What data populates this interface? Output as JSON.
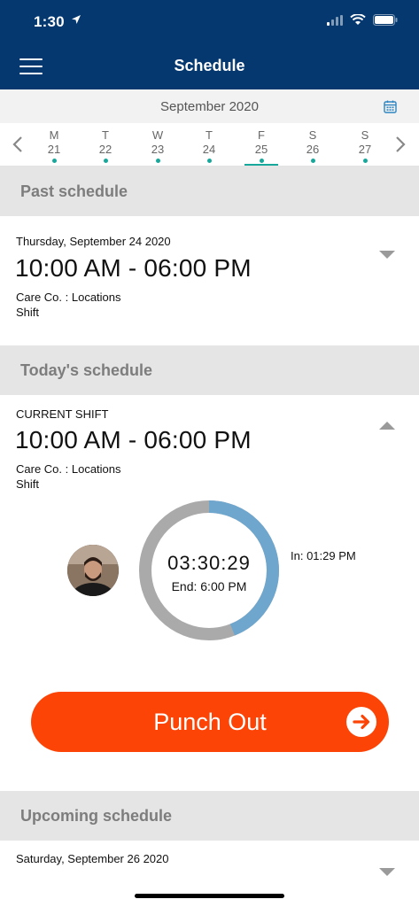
{
  "status_bar": {
    "time": "1:30"
  },
  "header": {
    "title": "Schedule"
  },
  "month": {
    "label": "September 2020"
  },
  "week": {
    "days": [
      {
        "name": "M",
        "date": "21"
      },
      {
        "name": "T",
        "date": "22"
      },
      {
        "name": "W",
        "date": "23"
      },
      {
        "name": "T",
        "date": "24"
      },
      {
        "name": "F",
        "date": "25"
      },
      {
        "name": "S",
        "date": "26"
      },
      {
        "name": "S",
        "date": "27"
      }
    ],
    "selected": "25"
  },
  "past": {
    "title": "Past schedule",
    "date": "Thursday, September 24 2020",
    "time": "10:00 AM - 06:00 PM",
    "company": "Care Co. : Locations",
    "type": "Shift"
  },
  "today": {
    "title": "Today's schedule",
    "label": "CURRENT SHIFT",
    "time": "10:00 AM - 06:00 PM",
    "company": "Care Co. : Locations",
    "type": "Shift",
    "timer": "03:30:29",
    "end": "End: 6:00 PM",
    "in": "In: 01:29 PM",
    "progress": 0.44
  },
  "punch": {
    "label": "Punch Out"
  },
  "upcoming": {
    "title": "Upcoming schedule",
    "date": "Saturday, September 26 2020"
  },
  "colors": {
    "header": "#04386f",
    "accent": "#17a89b",
    "punch": "#fd4407",
    "ring_progress": "#6fa6cd",
    "ring_track": "#aaaaaa"
  }
}
